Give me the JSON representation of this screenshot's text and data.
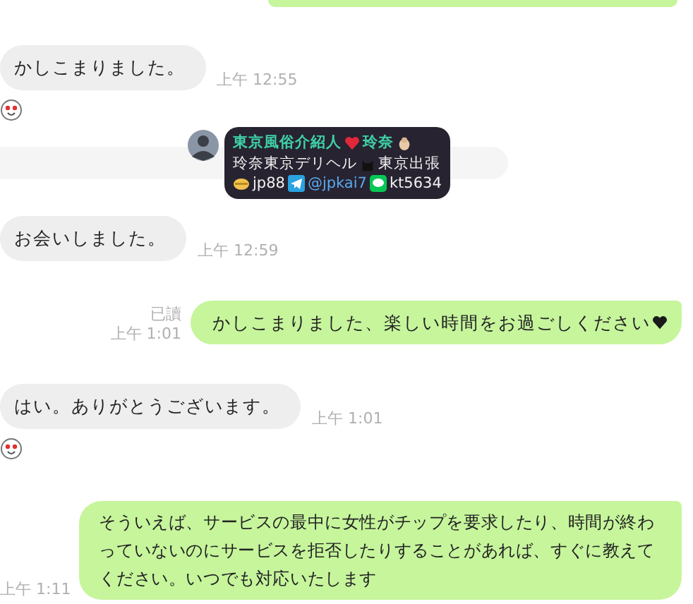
{
  "messages": [
    {
      "kind": "cut_sent"
    },
    {
      "kind": "received",
      "text": "かしこまりました。",
      "time": "上午 12:55",
      "reaction": true
    },
    {
      "kind": "hidden_received"
    },
    {
      "kind": "received",
      "text": "お会いしました。",
      "time": "上午 12:59",
      "reaction": false
    },
    {
      "kind": "sent",
      "text": "かしこまりました、楽しい時間をお過ごしください",
      "read_label": "已讀",
      "time": "上午 1:01"
    },
    {
      "kind": "received",
      "text": "はい。ありがとうございます。",
      "time": "上午 1:01",
      "reaction": true
    },
    {
      "kind": "sent",
      "text": "そういえば、サービスの最中に女性がチップを要求したり、時間が終わっていないのにサービスを拒否したりすることがあれば、すぐに教えてください。いつでも対応いたします"
    }
  ],
  "time_last": "上午 1:11",
  "popup": {
    "name": "東京風俗介紹人",
    "name_suffix": "玲奈",
    "line2_a": "玲奈東京デリヘル",
    "line2_b": "東京出張",
    "contacts": [
      {
        "kind": "coin",
        "text": "jp88"
      },
      {
        "kind": "telegram",
        "text": "@jpkai7"
      },
      {
        "kind": "line",
        "text": "kt5634"
      }
    ]
  }
}
